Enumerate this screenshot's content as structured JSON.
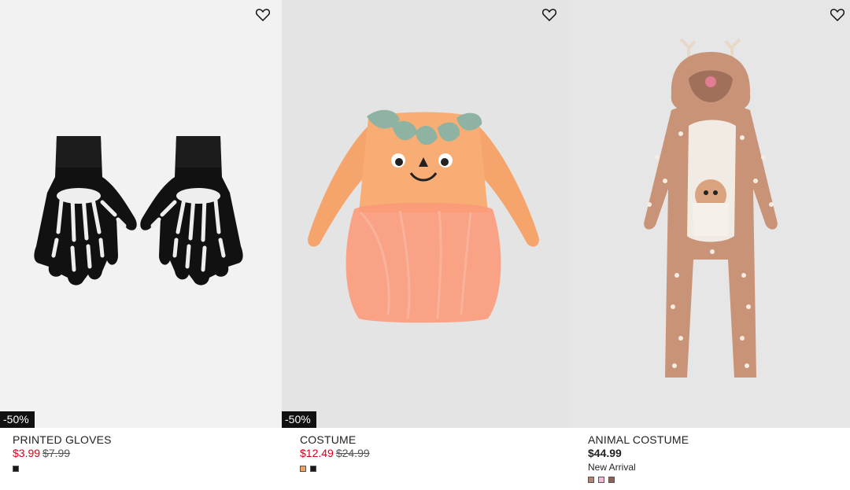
{
  "products": [
    {
      "name": "PRINTED GLOVES",
      "badge": "-50%",
      "sale_price": "$3.99",
      "original_price": "$7.99",
      "swatches": [
        "#1a1a1a"
      ]
    },
    {
      "name": "COSTUME",
      "badge": "-50%",
      "sale_price": "$12.49",
      "original_price": "$24.99",
      "swatches": [
        "#f0a060",
        "#1a1a1a"
      ]
    },
    {
      "name": "ANIMAL COSTUME",
      "price": "$44.99",
      "note": "New Arrival",
      "swatches": [
        "#b08670",
        "#f4b9d6",
        "#8a6354"
      ]
    }
  ],
  "colors": {
    "sale_red": "#d6001c",
    "badge_bg": "#111111"
  }
}
